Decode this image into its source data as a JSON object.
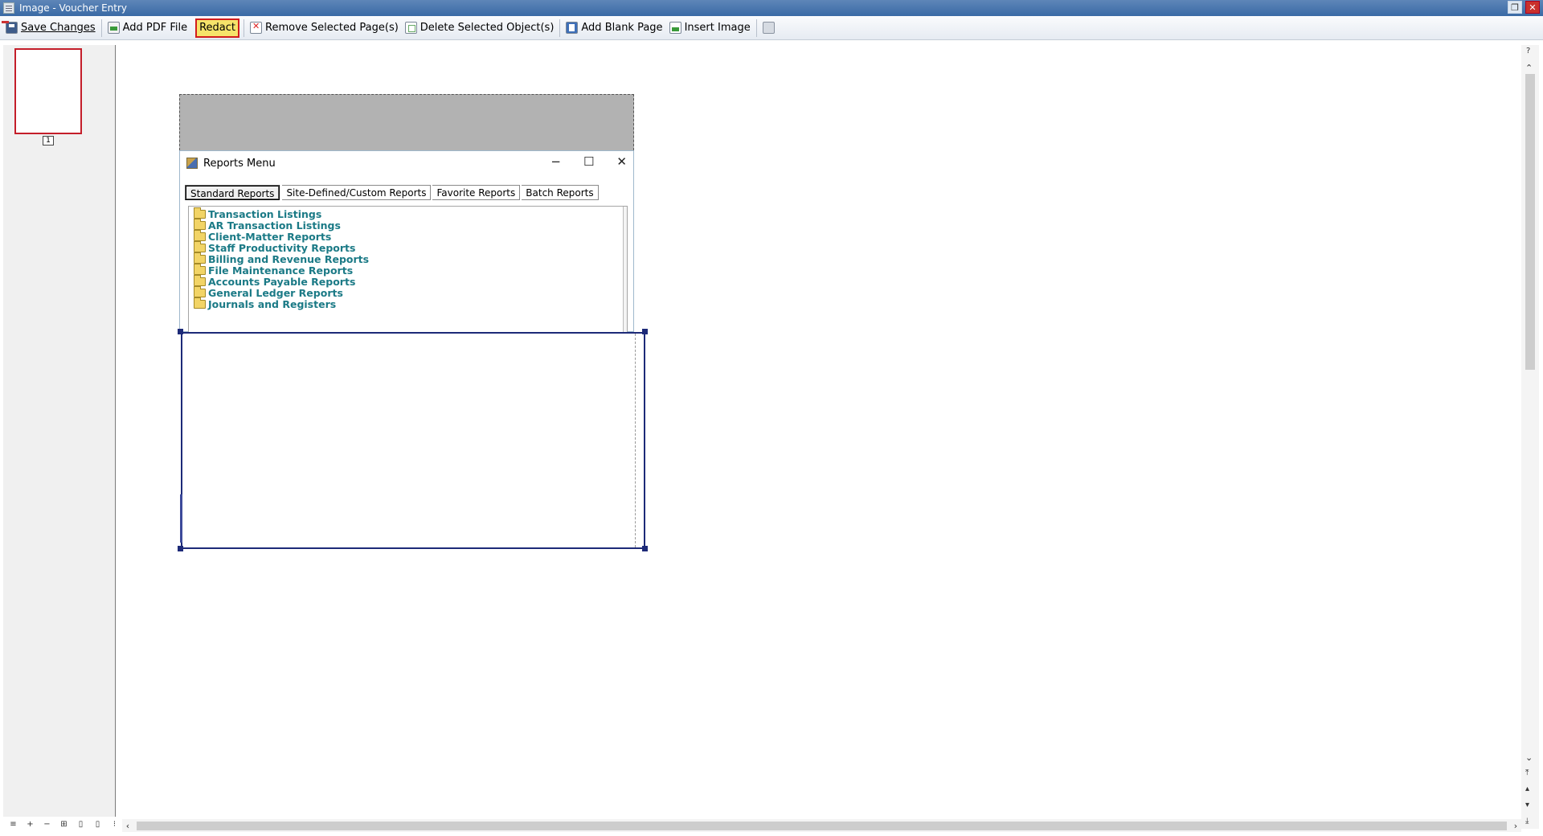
{
  "window": {
    "title": "Image - Voucher Entry",
    "restore_icon": "restore-icon",
    "close_icon": "close-icon"
  },
  "toolbar": {
    "save_changes": "Save Changes",
    "add_pdf_file": "Add PDF File",
    "redact": "Redact",
    "remove_selected_pages": "Remove Selected Page(s)",
    "delete_selected_objects": "Delete Selected Object(s)",
    "add_blank_page": "Add Blank Page",
    "insert_image": "Insert Image",
    "accent_highlight": "#f6e36a",
    "accent_border": "#d21d1d"
  },
  "thumbnails": {
    "pages": [
      {
        "number": "1",
        "selected": true
      }
    ],
    "selected_border_color": "#c41e2a"
  },
  "embedded_image": {
    "window_title": "Reports Menu",
    "tabs": [
      "Standard Reports",
      "Site-Defined/Custom Reports",
      "Favorite Reports",
      "Batch Reports"
    ],
    "active_tab": "Standard Reports",
    "tree_items": [
      "Transaction Listings",
      "AR Transaction Listings",
      "Client-Matter Reports",
      "Staff Productivity Reports",
      "Billing and Revenue Reports",
      "File Maintenance Reports",
      "Accounts Payable Reports",
      "General Ledger Reports",
      "Journals and Registers"
    ],
    "tree_item_color": "#1b7a86"
  },
  "scroll": {
    "help": "?"
  }
}
